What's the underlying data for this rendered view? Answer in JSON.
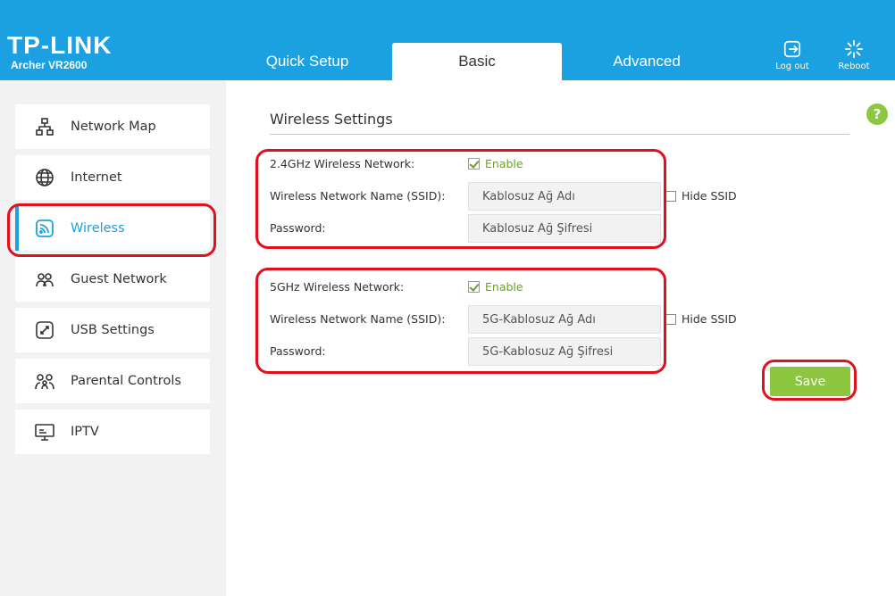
{
  "header": {
    "brand": "TP-LINK",
    "model": "Archer VR2600",
    "tabs": [
      {
        "label": "Quick Setup"
      },
      {
        "label": "Basic"
      },
      {
        "label": "Advanced"
      }
    ],
    "active_tab": "Basic",
    "logout_label": "Log out",
    "reboot_label": "Reboot"
  },
  "sidebar": {
    "items": [
      {
        "label": "Network Map",
        "icon": "network-map-icon"
      },
      {
        "label": "Internet",
        "icon": "globe-icon"
      },
      {
        "label": "Wireless",
        "icon": "wireless-icon"
      },
      {
        "label": "Guest Network",
        "icon": "guest-network-icon"
      },
      {
        "label": "USB Settings",
        "icon": "usb-icon"
      },
      {
        "label": "Parental Controls",
        "icon": "parental-controls-icon"
      },
      {
        "label": "IPTV",
        "icon": "iptv-icon"
      }
    ],
    "active_item": "Wireless"
  },
  "main": {
    "title": "Wireless Settings",
    "help_label": "?",
    "band24": {
      "network_label": "2.4GHz Wireless Network:",
      "enable_label": "Enable",
      "enabled": true,
      "ssid_label": "Wireless Network Name (SSID):",
      "ssid_value": "Kablosuz Ağ Adı",
      "hide_ssid_label": "Hide SSID",
      "hide_ssid": false,
      "password_label": "Password:",
      "password_value": "Kablosuz Ağ Şifresi"
    },
    "band5": {
      "network_label": "5GHz Wireless Network:",
      "enable_label": "Enable",
      "enabled": true,
      "ssid_label": "Wireless Network Name (SSID):",
      "ssid_value": "5G-Kablosuz Ağ Adı",
      "hide_ssid_label": "Hide SSID",
      "hide_ssid": false,
      "password_label": "Password:",
      "password_value": "5G-Kablosuz Ağ Şifresi"
    },
    "save_label": "Save"
  },
  "colors": {
    "header_blue": "#1ba1e2",
    "accent_green": "#8dc63f",
    "annotation_red": "#e0101f"
  }
}
